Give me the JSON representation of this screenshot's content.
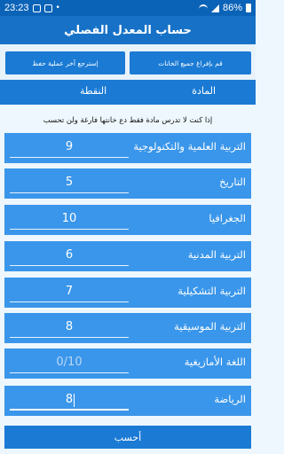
{
  "status": {
    "time": "23:23",
    "battery": "86%"
  },
  "app": {
    "title": "حساب المعدل الفصلي"
  },
  "actions": {
    "clear_label": "قم بإفراغ جميع الخانات",
    "restore_label": "إسترجع آخر عملية حفظ"
  },
  "table": {
    "subject_header": "المادة",
    "grade_header": "النقطة"
  },
  "hint": "إذا كنت لا تدرس مادة فقط دع خانتها فارغة ولن تحسب",
  "subjects": [
    {
      "name": "التربية العلمية والتكنولوجية",
      "value": "9",
      "placeholder": ""
    },
    {
      "name": "التاريخ",
      "value": "5",
      "placeholder": ""
    },
    {
      "name": "الجغرافيا",
      "value": "10",
      "placeholder": ""
    },
    {
      "name": "التربية المدنية",
      "value": "6",
      "placeholder": ""
    },
    {
      "name": "التربية التشكيلية",
      "value": "7",
      "placeholder": ""
    },
    {
      "name": "التربية الموسيقية",
      "value": "8",
      "placeholder": ""
    },
    {
      "name": "اللغة الأمازيغية",
      "value": "",
      "placeholder": "0/10"
    },
    {
      "name": "الرياضة",
      "value": "8",
      "placeholder": ""
    }
  ],
  "calculate_label": "أحسب",
  "colors": {
    "statusbar": "#0b63b8",
    "primary": "#1a7ad4",
    "row": "#3a96ea",
    "background": "#eef7fd"
  }
}
